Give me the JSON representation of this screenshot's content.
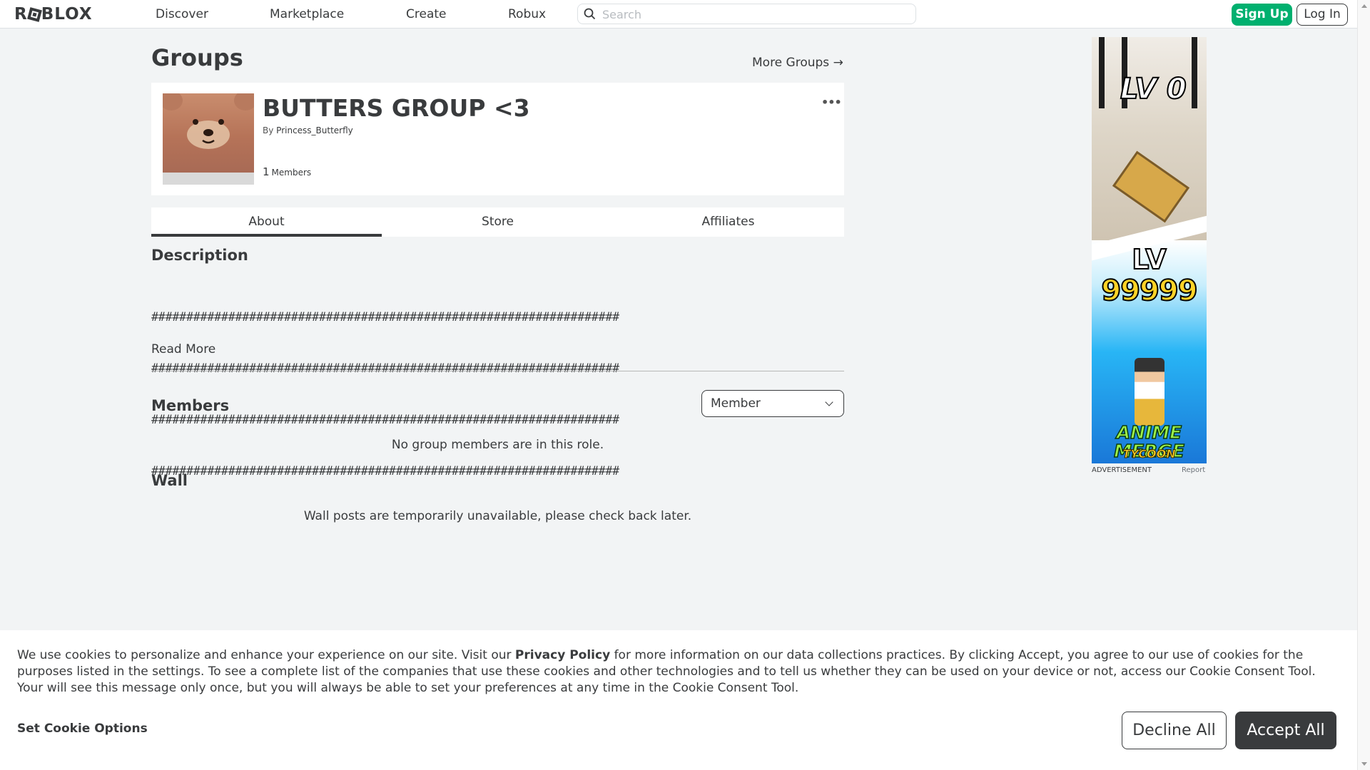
{
  "nav": {
    "logo": "ROBLOX",
    "links": [
      "Discover",
      "Marketplace",
      "Create",
      "Robux"
    ],
    "search_placeholder": "Search",
    "signup_label": "Sign Up",
    "login_label": "Log In"
  },
  "page": {
    "title": "Groups",
    "more_groups": "More Groups →"
  },
  "group": {
    "name": "BUTTERS GROUP <3",
    "by_prefix": "By",
    "owner": "Princess_Butterfly",
    "member_count": "1",
    "members_label": "Members",
    "menu": "•••"
  },
  "tabs": [
    {
      "label": "About",
      "active": true
    },
    {
      "label": "Store",
      "active": false
    },
    {
      "label": "Affiliates",
      "active": false
    }
  ],
  "about": {
    "description_heading": "Description",
    "description_lines": [
      "###################################################################",
      "###################################################################",
      "###################################################################",
      "###################################################################"
    ],
    "read_more": "Read More",
    "members_heading": "Members",
    "role_selected": "Member",
    "no_members_msg": "No group members are in this role.",
    "wall_heading": "Wall",
    "wall_msg": "Wall posts are temporarily unavailable, please check back later."
  },
  "ad": {
    "label": "ADVERTISEMENT",
    "report": "Report",
    "art_lv0": "LV 0",
    "art_lv": "LV",
    "art_num": "99999",
    "art_title": "ANIME MERGE",
    "art_sub": "TYCOON"
  },
  "cookie": {
    "text_before": "We use cookies to personalize and enhance your experience on our site. Visit our ",
    "privacy_link": "Privacy Policy",
    "text_after": " for more information on our data collections practices. By clicking Accept, you agree to our use of cookies for the purposes listed in the settings. To see a complete list of the companies that use these cookies and other technologies and to tell us whether they can be used on your device or not, access our Cookie Consent Tool. Your will see this message only once, but you will always be able to set your preferences at any time in the Cookie Consent Tool.",
    "set_options": "Set Cookie Options",
    "decline": "Decline All",
    "accept": "Accept All"
  },
  "colors": {
    "accent_green": "#00b06f",
    "text_dark": "#393b3d",
    "page_bg": "#f2f4f5"
  }
}
